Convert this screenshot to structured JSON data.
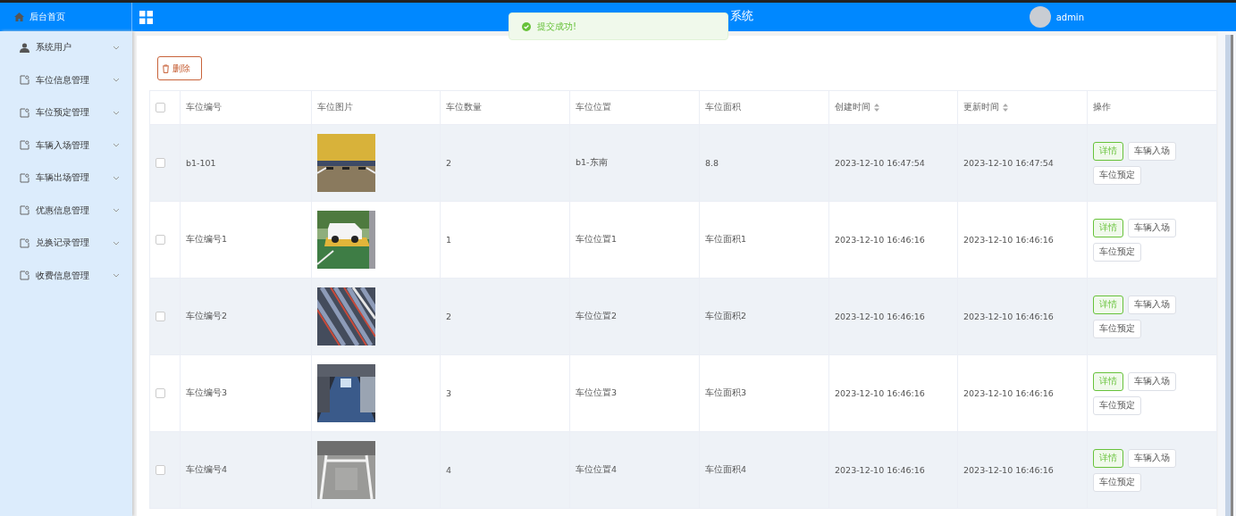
{
  "sidebar": {
    "home": "后台首页",
    "items": [
      {
        "label": "系统用户",
        "kind": "user",
        "expanded": false
      },
      {
        "label": "车位信息管理",
        "kind": "page",
        "expanded": false
      },
      {
        "label": "车位预定管理",
        "kind": "page",
        "expanded": false
      },
      {
        "label": "车辆入场管理",
        "kind": "page",
        "expanded": false
      },
      {
        "label": "车辆出场管理",
        "kind": "page",
        "expanded": false
      },
      {
        "label": "优惠信息管理",
        "kind": "page",
        "expanded": false
      },
      {
        "label": "兑换记录管理",
        "kind": "page",
        "expanded": false
      },
      {
        "label": "收费信息管理",
        "kind": "page",
        "expanded": false
      }
    ]
  },
  "header": {
    "title": "系统",
    "user": "admin"
  },
  "toast": {
    "kind": "success",
    "text": "提交成功!"
  },
  "toolbar": {
    "delete_button": "删除"
  },
  "table": {
    "all_checked": false,
    "columns": [
      {
        "label": "车位编号",
        "sortable": false
      },
      {
        "label": "车位图片",
        "sortable": false
      },
      {
        "label": "车位数量",
        "sortable": false
      },
      {
        "label": "车位位置",
        "sortable": false
      },
      {
        "label": "车位面积",
        "sortable": false
      },
      {
        "label": "创建时间",
        "sortable": true
      },
      {
        "label": "更新时间",
        "sortable": true
      },
      {
        "label": "操作",
        "sortable": false
      }
    ],
    "rows": [
      {
        "checked": false,
        "code": "b1-101",
        "count": "2",
        "location": "b1-东南",
        "area": "8.8",
        "created": "2023-12-10 16:47:54",
        "updated": "2023-12-10 16:47:54",
        "actions": [
          {
            "label": "详情",
            "kind": "primary"
          },
          {
            "label": "车辆入场",
            "kind": "default"
          },
          {
            "label": "车位预定",
            "kind": "default"
          }
        ]
      },
      {
        "checked": false,
        "code": "车位编号1",
        "count": "1",
        "location": "车位位置1",
        "area": "车位面积1",
        "created": "2023-12-10 16:46:16",
        "updated": "2023-12-10 16:46:16",
        "actions": [
          {
            "label": "详情",
            "kind": "primary"
          },
          {
            "label": "车辆入场",
            "kind": "default"
          },
          {
            "label": "车位预定",
            "kind": "default"
          }
        ]
      },
      {
        "checked": false,
        "code": "车位编号2",
        "count": "2",
        "location": "车位位置2",
        "area": "车位面积2",
        "created": "2023-12-10 16:46:16",
        "updated": "2023-12-10 16:46:16",
        "actions": [
          {
            "label": "详情",
            "kind": "primary"
          },
          {
            "label": "车辆入场",
            "kind": "default"
          },
          {
            "label": "车位预定",
            "kind": "default"
          }
        ]
      },
      {
        "checked": false,
        "code": "车位编号3",
        "count": "3",
        "location": "车位位置3",
        "area": "车位面积3",
        "created": "2023-12-10 16:46:16",
        "updated": "2023-12-10 16:46:16",
        "actions": [
          {
            "label": "详情",
            "kind": "primary"
          },
          {
            "label": "车辆入场",
            "kind": "default"
          },
          {
            "label": "车位预定",
            "kind": "default"
          }
        ]
      },
      {
        "checked": false,
        "code": "车位编号4",
        "count": "4",
        "location": "车位位置4",
        "area": "车位面积4",
        "created": "2023-12-10 16:46:16",
        "updated": "2023-12-10 16:46:16",
        "actions": [
          {
            "label": "详情",
            "kind": "primary"
          },
          {
            "label": "车辆入场",
            "kind": "default"
          },
          {
            "label": "车位预定",
            "kind": "default"
          }
        ]
      }
    ]
  }
}
